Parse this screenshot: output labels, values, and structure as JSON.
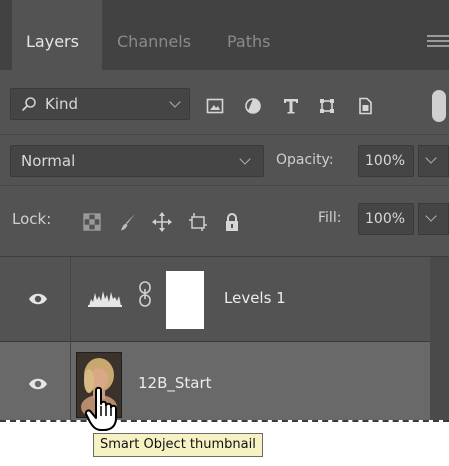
{
  "tabs": [
    {
      "label": "Layers",
      "active": true
    },
    {
      "label": "Channels",
      "active": false
    },
    {
      "label": "Paths",
      "active": false
    }
  ],
  "filter": {
    "kind_label": "Kind",
    "icons": [
      "image-filter-icon",
      "adjustment-filter-icon",
      "type-filter-icon",
      "shape-filter-icon",
      "smart-object-filter-icon"
    ]
  },
  "blend": {
    "mode": "Normal",
    "opacity_label": "Opacity:",
    "opacity_value": "100%"
  },
  "lock": {
    "label": "Lock:",
    "icons": [
      "lock-transparent-pixels-icon",
      "lock-image-pixels-icon",
      "lock-position-icon",
      "lock-artboard-icon",
      "lock-all-icon"
    ],
    "fill_label": "Fill:",
    "fill_value": "100%"
  },
  "layers": [
    {
      "name": "Levels 1",
      "visible": true,
      "type": "adjustment"
    },
    {
      "name": "12B_Start",
      "visible": true,
      "type": "smart-object",
      "selected": true
    }
  ],
  "tooltip": "Smart Object thumbnail",
  "colors": {
    "panel": "#535353",
    "tabbar": "#424242",
    "selected_row": "#696969",
    "tooltip_bg": "#f7f2c4"
  }
}
